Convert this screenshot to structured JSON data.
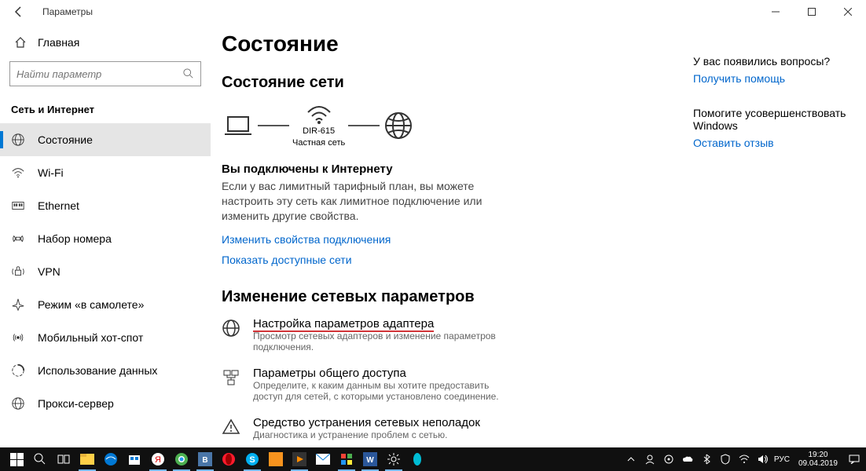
{
  "window": {
    "title": "Параметры"
  },
  "sidebar": {
    "home": "Главная",
    "search_placeholder": "Найти параметр",
    "section": "Сеть и Интернет",
    "items": [
      {
        "label": "Состояние",
        "active": true
      },
      {
        "label": "Wi-Fi"
      },
      {
        "label": "Ethernet"
      },
      {
        "label": "Набор номера"
      },
      {
        "label": "VPN"
      },
      {
        "label": "Режим «в самолете»"
      },
      {
        "label": "Мобильный хот-спот"
      },
      {
        "label": "Использование данных"
      },
      {
        "label": "Прокси-сервер"
      }
    ]
  },
  "main": {
    "title": "Состояние",
    "net_status_header": "Состояние сети",
    "wifi_name": "DIR-615",
    "wifi_type": "Частная сеть",
    "connected_title": "Вы подключены к Интернету",
    "connected_body": "Если у вас лимитный тарифный план, вы можете настроить эту сеть как лимитное подключение или изменить другие свойства.",
    "link_change_props": "Изменить свойства подключения",
    "link_show_nets": "Показать доступные сети",
    "change_params_header": "Изменение сетевых параметров",
    "actions": [
      {
        "title": "Настройка параметров адаптера",
        "desc": "Просмотр сетевых адаптеров и изменение параметров подключения."
      },
      {
        "title": "Параметры общего доступа",
        "desc": "Определите, к каким данным вы хотите предоставить доступ для сетей, с которыми установлено соединение."
      },
      {
        "title": "Средство устранения сетевых неполадок",
        "desc": "Диагностика и устранение проблем с сетью."
      }
    ]
  },
  "right": {
    "q1": "У вас появились вопросы?",
    "link1": "Получить помощь",
    "q2": "Помогите усовершенствовать Windows",
    "link2": "Оставить отзыв"
  },
  "taskbar": {
    "time": "19:20",
    "date": "09.04.2019",
    "lang": "РУС"
  }
}
